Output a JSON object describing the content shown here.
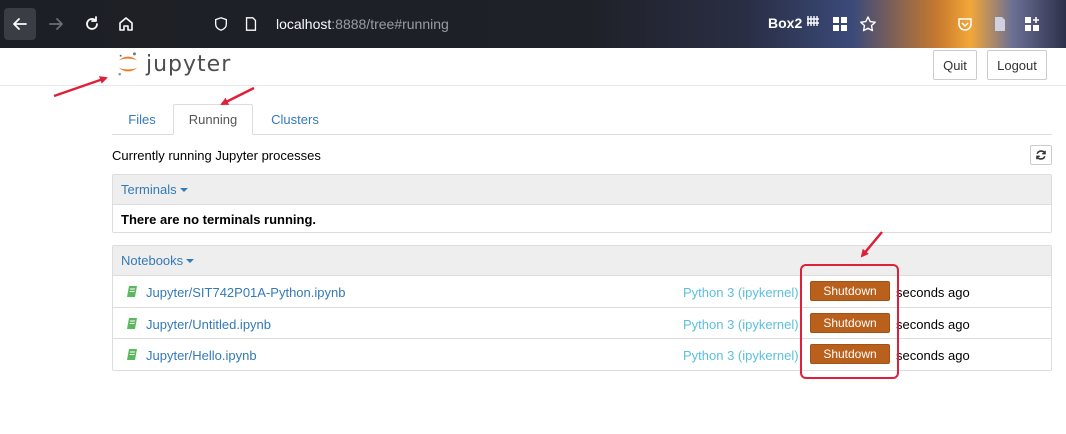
{
  "browser": {
    "url_host": "localhost",
    "url_rest": ":8888/tree#running",
    "profile_label": "Box2",
    "fence_glyph": "𝍸"
  },
  "header": {
    "logo_text": "jupyter",
    "quit_label": "Quit",
    "logout_label": "Logout"
  },
  "tabs": [
    {
      "label": "Files"
    },
    {
      "label": "Running"
    },
    {
      "label": "Clusters"
    }
  ],
  "running_label": "Currently running Jupyter processes",
  "terminals": {
    "title": "Terminals",
    "empty_message": "There are no terminals running."
  },
  "notebooks": {
    "title": "Notebooks",
    "rows": [
      {
        "name": "Jupyter/SIT742P01A-Python.ipynb",
        "kernel": "Python 3 (ipykernel)",
        "action": "Shutdown",
        "time": "seconds ago"
      },
      {
        "name": "Jupyter/Untitled.ipynb",
        "kernel": "Python 3 (ipykernel)",
        "action": "Shutdown",
        "time": "seconds ago"
      },
      {
        "name": "Jupyter/Hello.ipynb",
        "kernel": "Python 3 (ipykernel)",
        "action": "Shutdown",
        "time": "seconds ago"
      }
    ]
  },
  "colors": {
    "link": "#337ab7",
    "kernel": "#5bc0de",
    "shutdown": "#b9601d",
    "annotation": "#e0203a"
  },
  "icons": [
    "back-arrow-icon",
    "forward-arrow-icon",
    "reload-icon",
    "home-icon",
    "shield-icon",
    "page-icon",
    "grid-icon",
    "star-icon",
    "pocket-icon",
    "document-icon",
    "extensions-icon",
    "refresh-icon",
    "notebook-icon"
  ]
}
